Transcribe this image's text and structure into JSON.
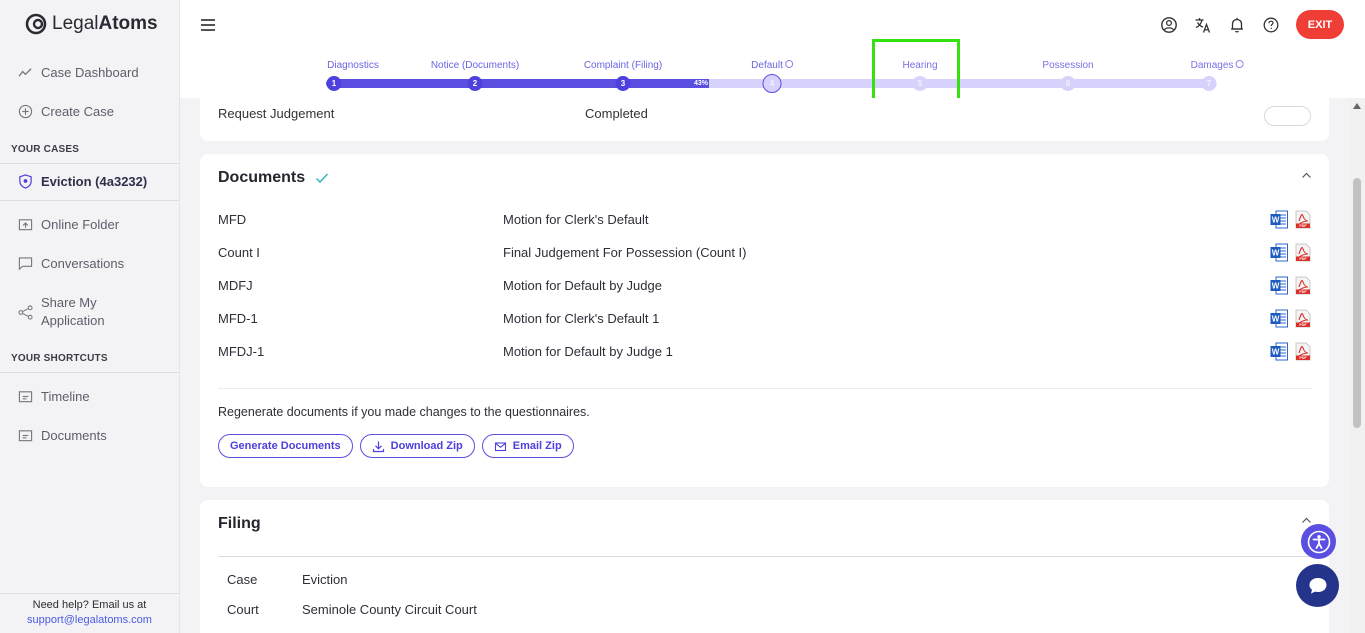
{
  "app": {
    "logo_light": "Legal",
    "logo_bold": "Atoms"
  },
  "sidebar": {
    "items": [
      {
        "label": "Case Dashboard"
      },
      {
        "label": "Create Case"
      }
    ],
    "your_cases_title": "YOUR CASES",
    "active_case": "Eviction (4a3232)",
    "case_items": [
      {
        "label": "Online Folder"
      },
      {
        "label": "Conversations"
      },
      {
        "label_line1": "Share My",
        "label_line2": "Application"
      }
    ],
    "shortcuts_title": "YOUR SHORTCUTS",
    "shortcut_items": [
      {
        "label": "Timeline"
      },
      {
        "label": "Documents"
      }
    ],
    "help_text": "Need help? Email us at",
    "help_email": "support@legalatoms.com"
  },
  "topbar": {
    "exit_label": "EXIT"
  },
  "stepper": {
    "progress_percent_label": "43%",
    "progress_fraction": 0.43,
    "steps": [
      {
        "label": "Diagnostics",
        "number": "1",
        "state": "done"
      },
      {
        "label": "Notice (Documents)",
        "number": "2",
        "state": "done"
      },
      {
        "label": "Complaint (Filing)",
        "number": "3",
        "state": "done"
      },
      {
        "label": "Default",
        "number": "4",
        "state": "current"
      },
      {
        "label": "Hearing",
        "number": "5",
        "state": "future"
      },
      {
        "label": "Possession",
        "number": "6",
        "state": "future"
      },
      {
        "label": "Damages",
        "number": "7",
        "state": "future"
      }
    ]
  },
  "prev_card": {
    "row_label": "Request Judgement",
    "row_status": "Completed"
  },
  "documents": {
    "title": "Documents",
    "rows": [
      {
        "code": "MFD",
        "name": "Motion for Clerk's Default"
      },
      {
        "code": "Count I",
        "name": "Final Judgement For Possession (Count I)"
      },
      {
        "code": "MDFJ",
        "name": "Motion for Default by Judge"
      },
      {
        "code": "MFD-1",
        "name": "Motion for Clerk's Default 1"
      },
      {
        "code": "MFDJ-1",
        "name": "Motion for Default by Judge 1"
      }
    ],
    "regen_text": "Regenerate documents if you made changes to the questionnaires.",
    "buttons": {
      "generate": "Generate Documents",
      "download": "Download Zip",
      "email": "Email Zip"
    }
  },
  "filing": {
    "title": "Filing",
    "rows": [
      {
        "key": "Case",
        "value": "Eviction"
      },
      {
        "key": "Court",
        "value": "Seminole County Circuit Court"
      }
    ]
  }
}
